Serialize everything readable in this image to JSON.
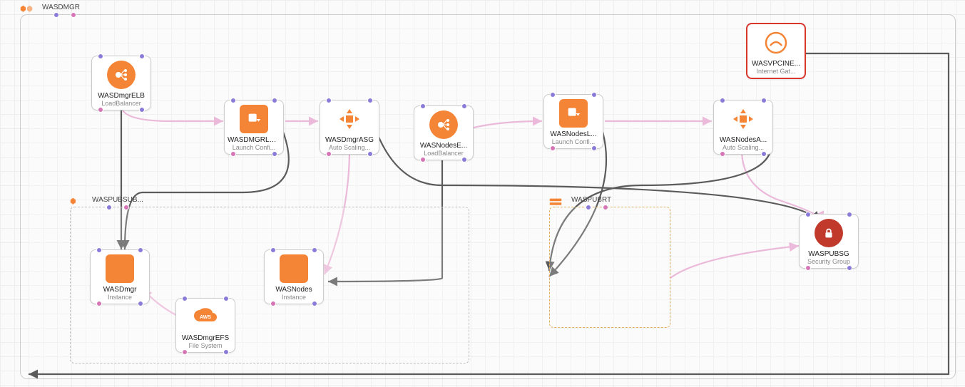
{
  "diagram": {
    "root_group": {
      "label": "WASDMGR"
    },
    "subnet_group": {
      "label": "WASPUBSUB..."
    },
    "routetable_group": {
      "label": "WASPUBRT"
    }
  },
  "nodes": {
    "wasvpcine": {
      "title": "WASVPCINE...",
      "subtitle": "Internet Gat..."
    },
    "wasdmgrelb": {
      "title": "WASDmgrELB",
      "subtitle": "LoadBalancer"
    },
    "wasdmgrlc": {
      "title": "WASDMGRLC...",
      "subtitle": "Launch Confi..."
    },
    "wasdmgrasg": {
      "title": "WASDmgrASG",
      "subtitle": "Auto Scaling..."
    },
    "wasnodese": {
      "title": "WASNodesE...",
      "subtitle": "LoadBalancer"
    },
    "wasnodesl": {
      "title": "WASNodesL...",
      "subtitle": "Launch Confi..."
    },
    "wasnodesa": {
      "title": "WASNodesA...",
      "subtitle": "Auto Scaling..."
    },
    "waspubsg": {
      "title": "WASPUBSG",
      "subtitle": "Security Group"
    },
    "wasdmgr": {
      "title": "WASDmgr",
      "subtitle": "Instance"
    },
    "wasnodes": {
      "title": "WASNodes",
      "subtitle": "Instance"
    },
    "wasdmgrefs": {
      "title": "WASDmgrEFS",
      "subtitle": "File System"
    }
  },
  "colors": {
    "orange": "#f58536",
    "darkorange": "#e8731f",
    "red": "#c0392b",
    "purple_port": "#8a7bd8",
    "pink_edge": "#e6a8d0",
    "dark_edge": "#333333"
  }
}
